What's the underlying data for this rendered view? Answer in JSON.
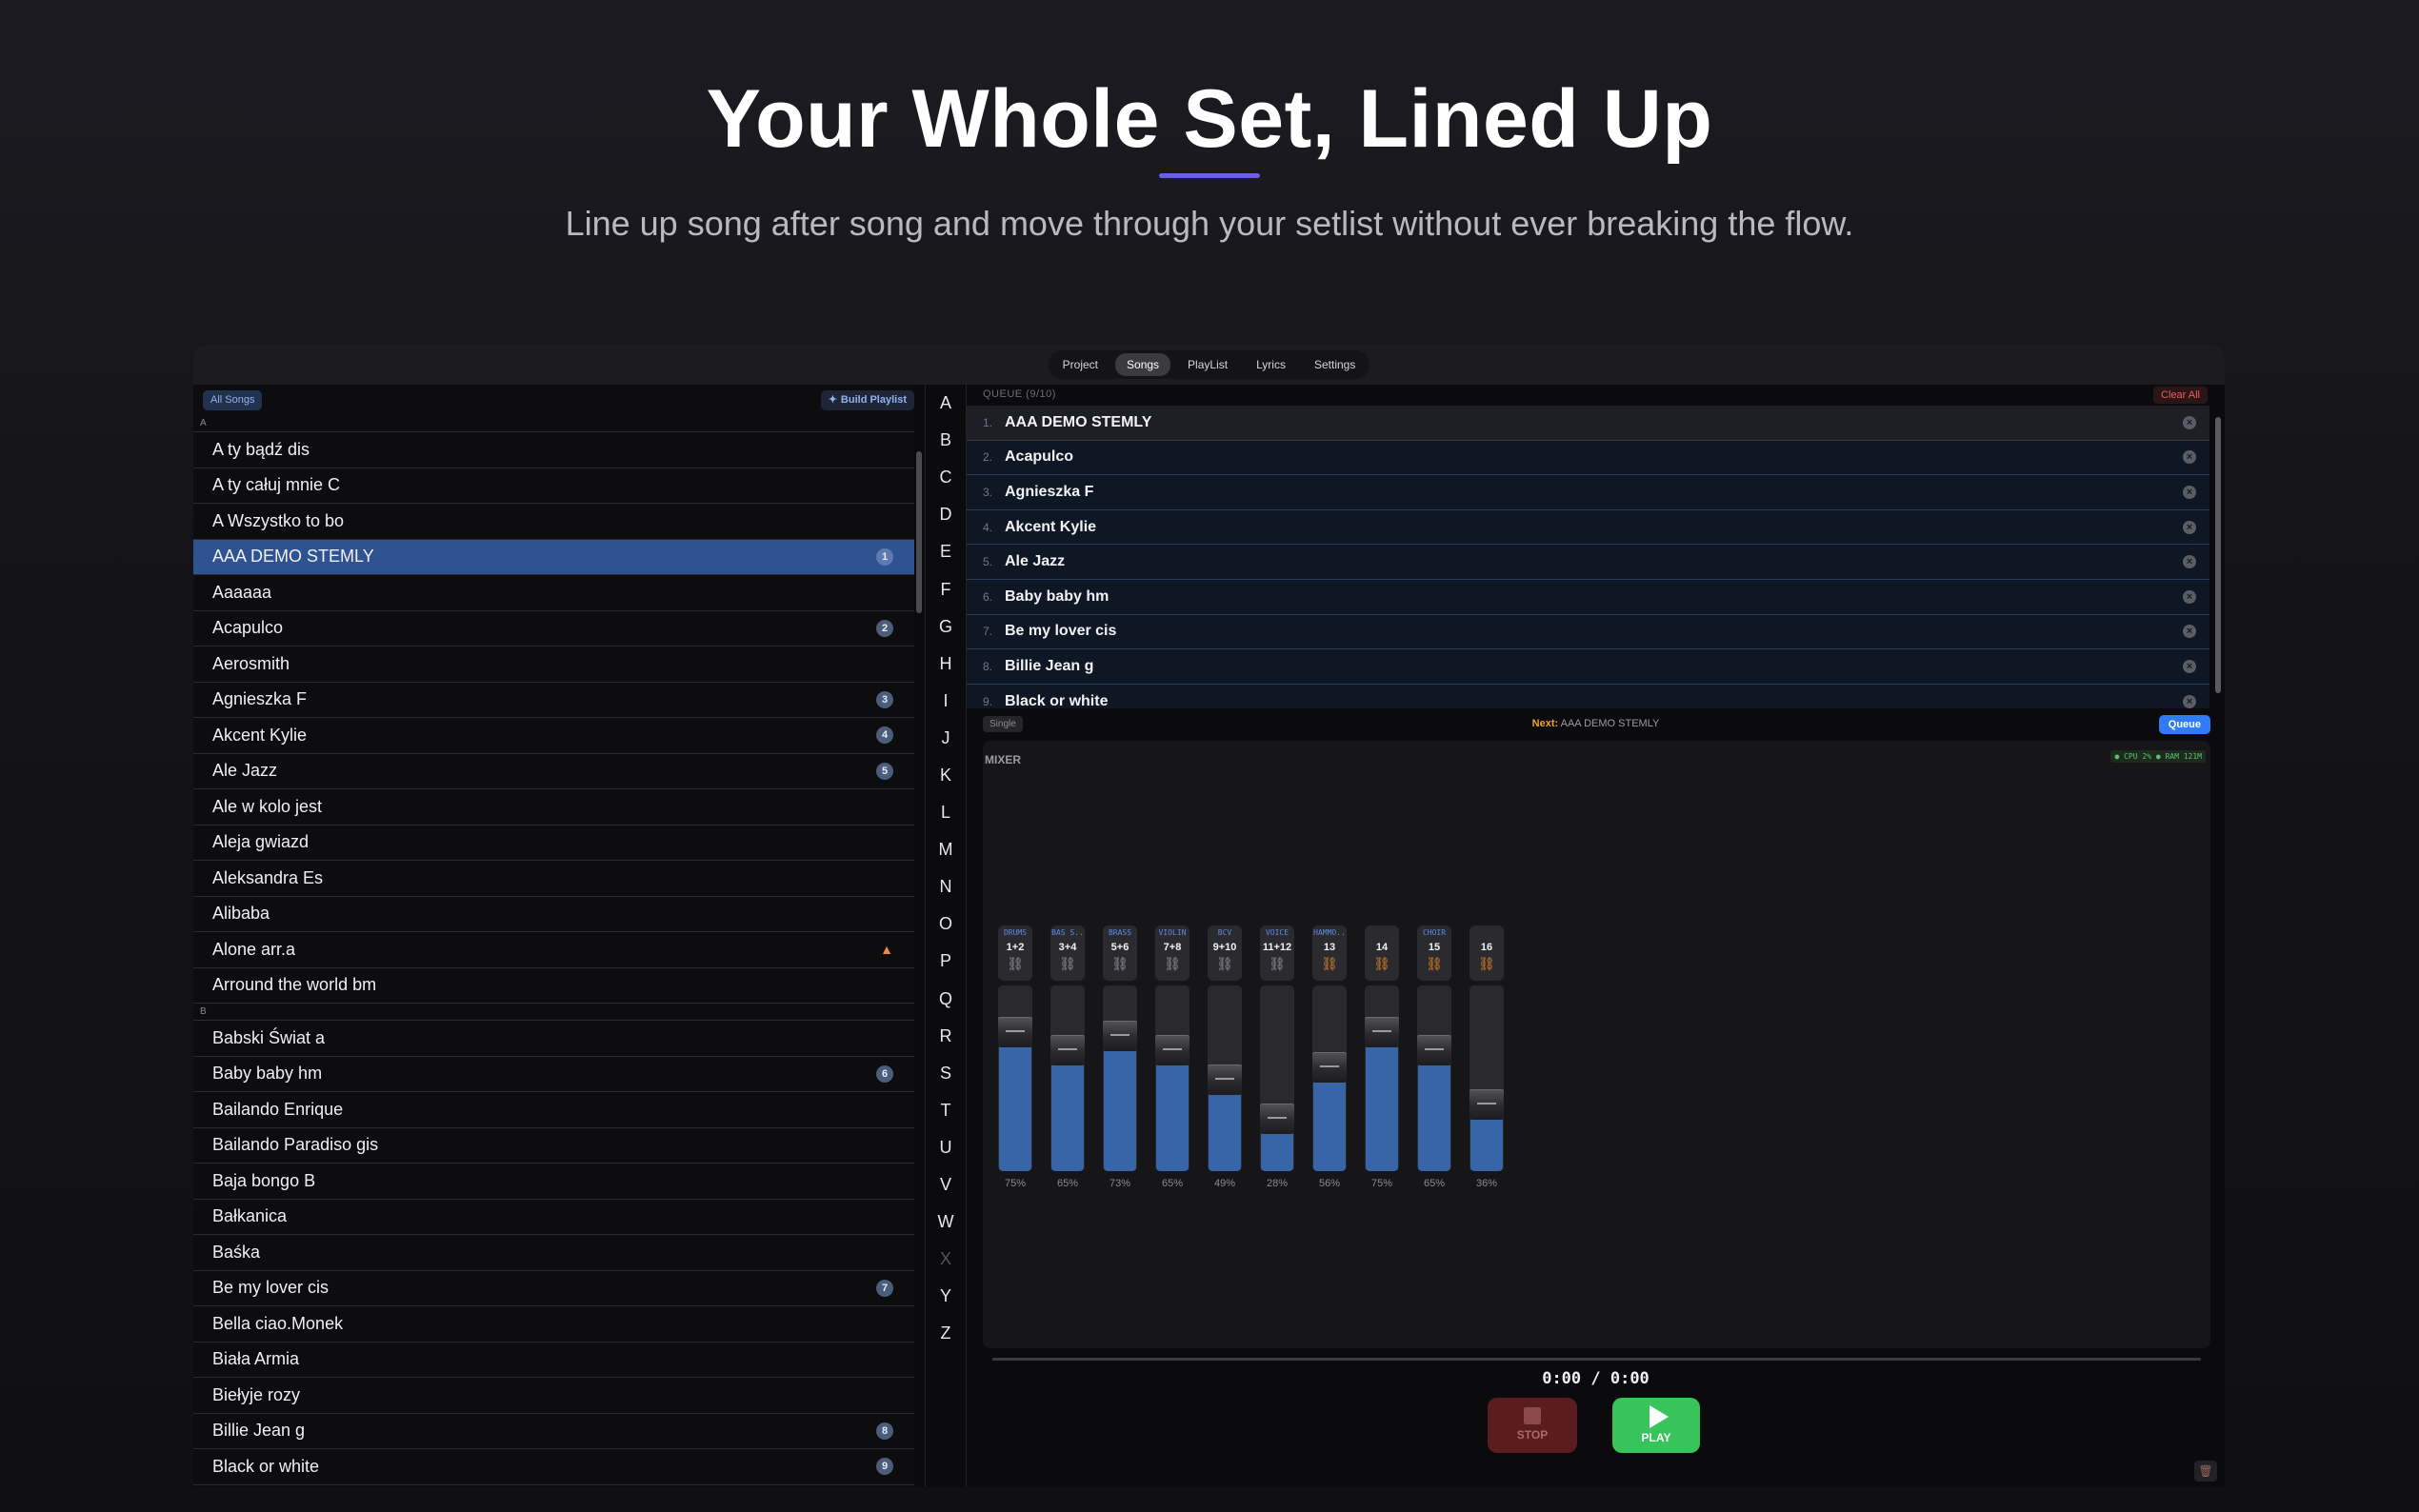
{
  "hero": {
    "title": "Your Whole Set, Lined Up",
    "subtitle": "Line up song after song and move through your setlist without ever breaking the flow."
  },
  "topbar": {
    "tabs": [
      {
        "label": "Project",
        "active": false
      },
      {
        "label": "Songs",
        "active": true
      },
      {
        "label": "PlayList",
        "active": false
      },
      {
        "label": "Lyrics",
        "active": false
      },
      {
        "label": "Settings",
        "active": false
      }
    ]
  },
  "songs": {
    "filter_label": "All Songs",
    "build_label": "Build Playlist",
    "groups": [
      {
        "letter": "A",
        "items": [
          {
            "title": "A ty bądź dis"
          },
          {
            "title": "A ty całuj mnie C"
          },
          {
            "title": "A Wszystko to bo"
          },
          {
            "title": "AAA DEMO STEMLY",
            "badge": "1",
            "selected": true
          },
          {
            "title": "Aaaaaa"
          },
          {
            "title": "Acapulco",
            "badge": "2"
          },
          {
            "title": "Aerosmith"
          },
          {
            "title": "Agnieszka F",
            "badge": "3"
          },
          {
            "title": "Akcent Kylie",
            "badge": "4"
          },
          {
            "title": "Ale Jazz",
            "badge": "5"
          },
          {
            "title": "Ale w kolo jest"
          },
          {
            "title": "Aleja gwiazd"
          },
          {
            "title": "Aleksandra Es"
          },
          {
            "title": "Alibaba"
          },
          {
            "title": "Alone arr.a",
            "warning": true
          },
          {
            "title": "Arround the world bm"
          }
        ]
      },
      {
        "letter": "B",
        "items": [
          {
            "title": "Babski Świat a"
          },
          {
            "title": "Baby baby hm",
            "badge": "6"
          },
          {
            "title": "Bailando Enrique"
          },
          {
            "title": "Bailando Paradiso gis"
          },
          {
            "title": "Baja bongo B"
          },
          {
            "title": "Bałkanica"
          },
          {
            "title": "Baśka"
          },
          {
            "title": "Be my lover cis",
            "badge": "7"
          },
          {
            "title": "Bella ciao.Monek"
          },
          {
            "title": "Biała Armia"
          },
          {
            "title": "Biełyje rozy"
          },
          {
            "title": "Billie Jean g",
            "badge": "8"
          },
          {
            "title": "Black or white",
            "badge": "9"
          }
        ]
      }
    ]
  },
  "alphabet": [
    "A",
    "B",
    "C",
    "D",
    "E",
    "F",
    "G",
    "H",
    "I",
    "J",
    "K",
    "L",
    "M",
    "N",
    "O",
    "P",
    "Q",
    "R",
    "S",
    "T",
    "U",
    "V",
    "W",
    "X",
    "Y",
    "Z"
  ],
  "alphabet_disabled": [
    "X"
  ],
  "queue": {
    "title": "QUEUE (9/10)",
    "clear_label": "Clear All",
    "items": [
      {
        "num": "1.",
        "title": "AAA DEMO STEMLY"
      },
      {
        "num": "2.",
        "title": "Acapulco"
      },
      {
        "num": "3.",
        "title": "Agnieszka F"
      },
      {
        "num": "4.",
        "title": "Akcent Kylie"
      },
      {
        "num": "5.",
        "title": "Ale Jazz"
      },
      {
        "num": "6.",
        "title": "Baby baby hm"
      },
      {
        "num": "7.",
        "title": "Be my lover cis"
      },
      {
        "num": "8.",
        "title": "Billie Jean g"
      },
      {
        "num": "9.",
        "title": "Black or white"
      }
    ],
    "mode_label": "Single",
    "next_label": "Next:",
    "next_song": "AAA DEMO STEMLY",
    "queue_button": "Queue"
  },
  "mixer": {
    "title": "MIXER",
    "system_status": "● CPU 2% ● RAM 121M",
    "channels": [
      {
        "name": "DRUMS",
        "num": "1+2",
        "linked": false,
        "level": 0.75,
        "pct": "75%"
      },
      {
        "name": "BAS S..",
        "num": "3+4",
        "linked": false,
        "level": 0.65,
        "pct": "65%"
      },
      {
        "name": "BRASS",
        "num": "5+6",
        "linked": false,
        "level": 0.73,
        "pct": "73%"
      },
      {
        "name": "VIOLIN",
        "num": "7+8",
        "linked": false,
        "level": 0.65,
        "pct": "65%"
      },
      {
        "name": "BCV",
        "num": "9+10",
        "linked": false,
        "level": 0.49,
        "pct": "49%"
      },
      {
        "name": "VOICE",
        "num": "11+12",
        "linked": false,
        "level": 0.28,
        "pct": "28%"
      },
      {
        "name": "HAMMO..",
        "num": "13",
        "linked": true,
        "level": 0.56,
        "pct": "56%"
      },
      {
        "name": "",
        "num": "14",
        "linked": true,
        "level": 0.75,
        "pct": "75%"
      },
      {
        "name": "CHOIR",
        "num": "15",
        "linked": true,
        "level": 0.65,
        "pct": "65%"
      },
      {
        "name": "",
        "num": "16",
        "linked": true,
        "level": 0.36,
        "pct": "36%"
      }
    ]
  },
  "transport": {
    "time": "0:00 / 0:00",
    "stop_label": "STOP",
    "play_label": "PLAY"
  },
  "colors": {
    "accent": "#6c5ce7",
    "selected_row": "#2f5390",
    "fader_fill": "#3864a8",
    "play": "#38c45a",
    "stop": "#5a1c1e",
    "queue_button": "#2f7cf6",
    "link_orange": "#e8892c"
  },
  "icons": {
    "build": "sparkle-icon",
    "link": "link-icon",
    "remove": "close-circle-icon",
    "warning": "warning-icon",
    "stop": "stop-icon",
    "play": "play-icon",
    "trash": "trash-icon"
  }
}
